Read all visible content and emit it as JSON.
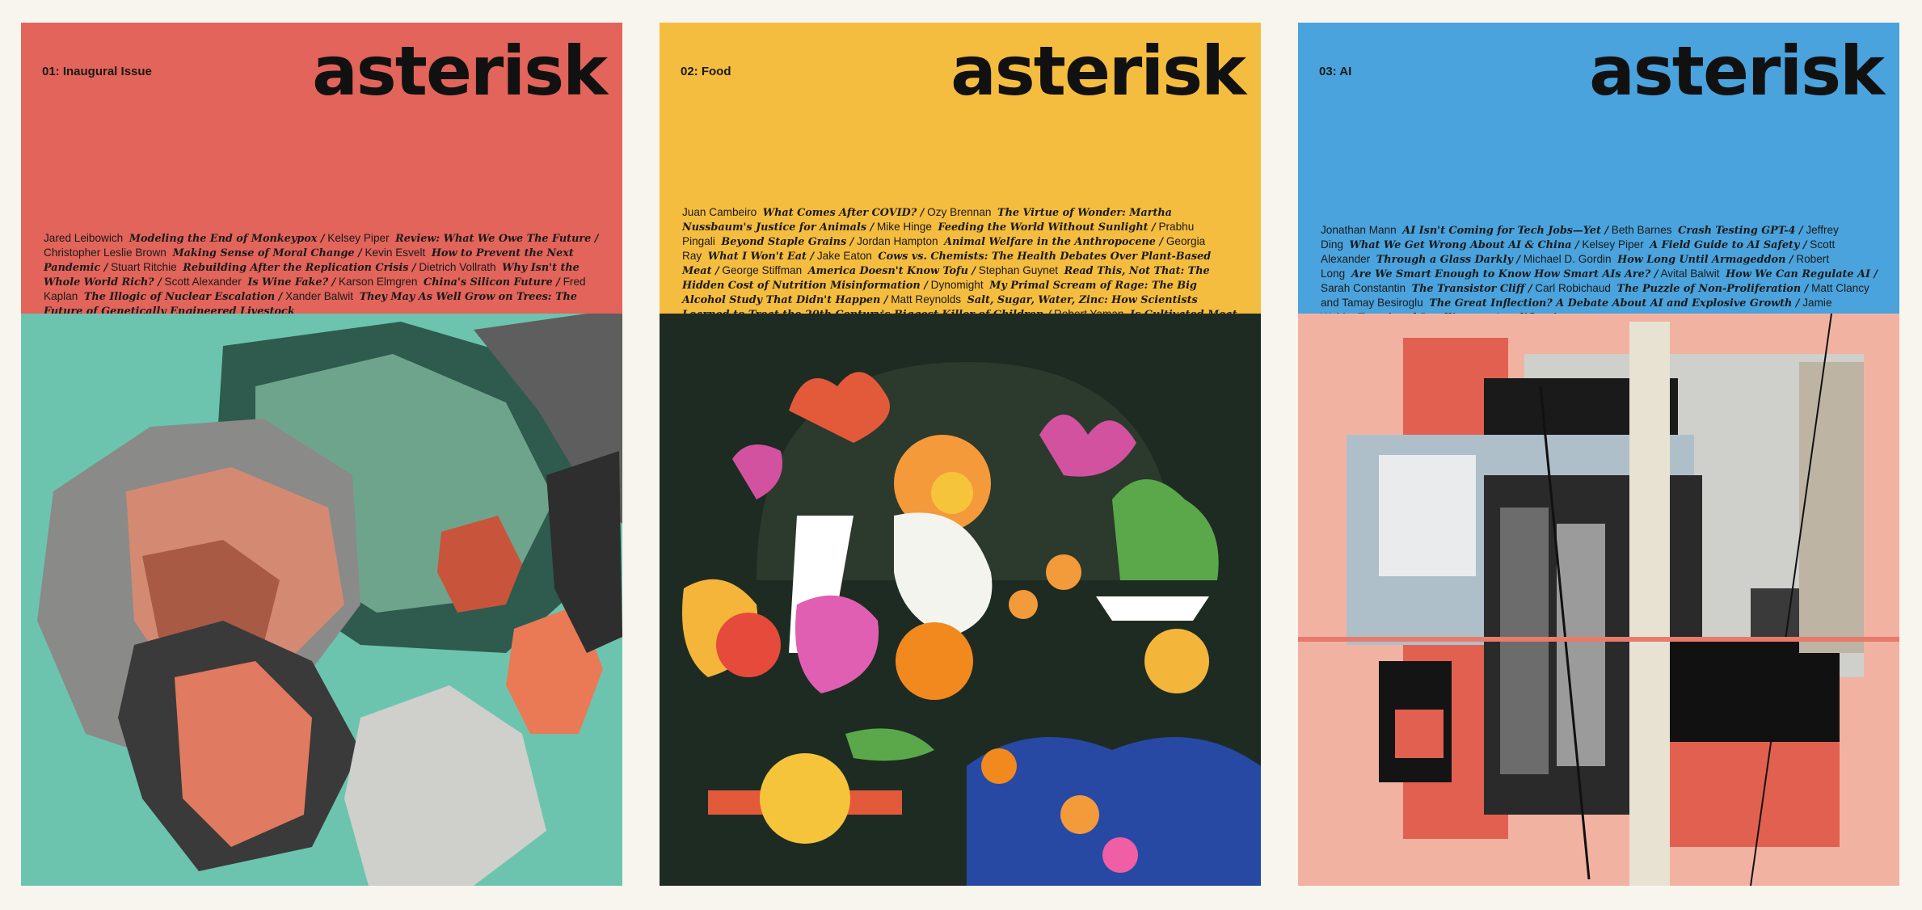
{
  "covers": [
    {
      "issue": "01: Inaugural Issue",
      "logo": "asterisk",
      "band_color": "#e2645a",
      "art_bg": "#6cc4ae",
      "contents": [
        {
          "author": "Jared Leibowich",
          "title": "Modeling the End of Monkeypox /"
        },
        {
          "author": "Kelsey Piper",
          "title": "Review: What We Owe The Future /"
        },
        {
          "author": "Christopher Leslie Brown",
          "title": "Making Sense of Moral Change /"
        },
        {
          "author": "Kevin Esvelt",
          "title": "How to Prevent the Next Pandemic /"
        },
        {
          "author": "Stuart Ritchie",
          "title": "Rebuilding After the Replication Crisis /"
        },
        {
          "author": "Dietrich Vollrath",
          "title": "Why Isn't the Whole World Rich? /"
        },
        {
          "author": "Scott Alexander",
          "title": "Is Wine Fake? /"
        },
        {
          "author": "Karson Elmgren",
          "title": "China's Silicon Future /"
        },
        {
          "author": "Fred Kaplan",
          "title": "The Illogic of Nuclear Escalation /"
        },
        {
          "author": "Xander Balwit",
          "title": "They May As Well Grow on Trees: The Future of Genetically Engineered Livestock"
        }
      ]
    },
    {
      "issue": "02: Food",
      "logo": "asterisk",
      "band_color": "#f5bd3f",
      "art_bg": "#1e2b22",
      "contents": [
        {
          "author": "Juan Cambeiro",
          "title": "What Comes After COVID? /"
        },
        {
          "author": "Ozy Brennan",
          "title": "The Virtue of Wonder: Martha Nussbaum's Justice for Animals /"
        },
        {
          "author": "Mike Hinge",
          "title": "Feeding the World Without Sunlight /"
        },
        {
          "author": "Prabhu Pingali",
          "title": "Beyond Staple Grains /"
        },
        {
          "author": "Jordan Hampton",
          "title": "Animal Welfare in the Anthropocene /"
        },
        {
          "author": "Georgia Ray",
          "title": "What I Won't Eat /"
        },
        {
          "author": "Jake Eaton",
          "title": "Cows vs. Chemists: The Health Debates Over Plant-Based Meat /"
        },
        {
          "author": "George Stiffman",
          "title": "America Doesn't Know Tofu /"
        },
        {
          "author": "Stephan Guynet",
          "title": "Read This, Not That: The Hidden Cost of Nutrition Misinformation /"
        },
        {
          "author": "Dynomight",
          "title": "My Primal Scream of Rage: The Big Alcohol Study That Didn't Happen /"
        },
        {
          "author": "Matt Reynolds",
          "title": "Salt, Sugar, Water, Zinc: How Scientists Learned to Treat the 20th Century's Biggest Killer of Children /"
        },
        {
          "author": "Robert Yaman",
          "title": "Is Cultivated Meat For Real?"
        }
      ]
    },
    {
      "issue": "03: AI",
      "logo": "asterisk",
      "band_color": "#4aa3dc",
      "art_bg": "#f2b2a2",
      "contents": [
        {
          "author": "Jonathan Mann",
          "title": "AI Isn't Coming for Tech Jobs—Yet /"
        },
        {
          "author": "Beth Barnes",
          "title": "Crash Testing GPT-4 /"
        },
        {
          "author": "Jeffrey Ding",
          "title": "What We Get Wrong About AI & China /"
        },
        {
          "author": "Kelsey Piper",
          "title": "A Field Guide to AI Safety /"
        },
        {
          "author": "Scott Alexander",
          "title": "Through a Glass Darkly /"
        },
        {
          "author": "Michael D. Gordin",
          "title": "How Long Until Armageddon /"
        },
        {
          "author": "Robert Long",
          "title": "Are We Smart Enough to Know How Smart AIs Are? /"
        },
        {
          "author": "Avital Balwit",
          "title": "How We Can Regulate AI /"
        },
        {
          "author": "Sarah Constantin",
          "title": "The Transistor Cliff /"
        },
        {
          "author": "Carl Robichaud",
          "title": "The Puzzle of Non-Proliferation /"
        },
        {
          "author": "Matt Clancy and Tamay Besiroglu",
          "title": "The Great Inflection? A Debate About AI and Explosive Growth /"
        },
        {
          "author": "Jamie Wahls",
          "title": "Emotional Intelligence Amplification"
        }
      ]
    }
  ]
}
